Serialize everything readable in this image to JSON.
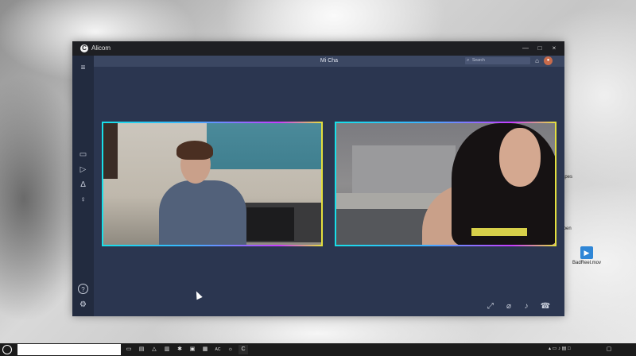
{
  "window": {
    "title": "Alicom",
    "minimize": "—",
    "maximize": "□",
    "close": "×"
  },
  "header": {
    "contact_name": "Mi Cha",
    "search_placeholder": "Search"
  },
  "sidebar": {
    "items": [
      {
        "icon": "menu-icon",
        "glyph": "≡"
      },
      {
        "icon": "video-call-icon",
        "glyph": "▭"
      },
      {
        "icon": "play-icon",
        "glyph": "▷"
      },
      {
        "icon": "contacts-group-icon",
        "glyph": "∆"
      },
      {
        "icon": "person-icon",
        "glyph": "♀"
      },
      {
        "icon": "help-icon",
        "glyph": "?"
      },
      {
        "icon": "settings-icon",
        "glyph": "⚙"
      }
    ]
  },
  "controls": {
    "fullscreen": "⤢",
    "mute": "⌀",
    "volume": "♪",
    "hangup": "☎"
  },
  "desktop": {
    "icons": [
      {
        "label": "Tapes"
      },
      {
        "label": "Open"
      },
      {
        "label": "BadReel.mov"
      }
    ]
  },
  "taskbar": {
    "tray_text": "▴ ▭ ♪ ▤ □",
    "ime": "AC"
  }
}
